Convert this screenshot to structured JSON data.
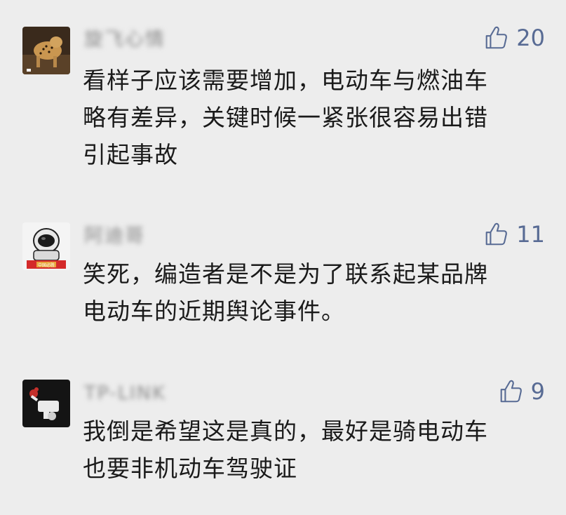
{
  "comments": [
    {
      "username": "旋飞心情",
      "likes": "20",
      "lines": [
        "看样子应该需要增加，电动车与燃油车",
        "略有差异，关键时候一紧张很容易出错",
        "引起事故"
      ],
      "avatar_icon": "cheetah-avatar"
    },
    {
      "username": "阿迪哥",
      "likes": "11",
      "lines": [
        "笑死，编造者是不是为了联系起某品牌",
        "电动车的近期舆论事件。"
      ],
      "avatar_icon": "astronaut-avatar",
      "avatar_badge": "中国必胜"
    },
    {
      "username": "TP-LINK",
      "likes": "9",
      "lines": [
        "我倒是希望这是真的，最好是骑电动车",
        "也要非机动车驾驶证"
      ],
      "avatar_icon": "cartoon-avatar"
    }
  ],
  "colors": {
    "background": "#ededed",
    "like_color": "#586b94",
    "text_color": "#1a1a1a"
  }
}
